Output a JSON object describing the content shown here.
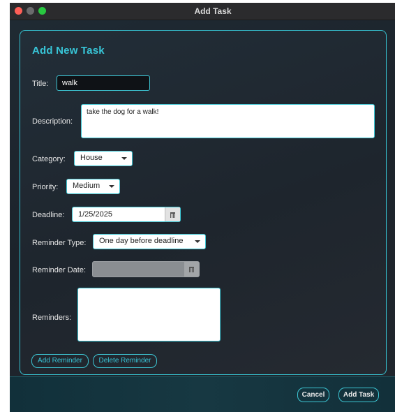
{
  "window": {
    "title": "Add Task"
  },
  "form": {
    "heading": "Add New Task",
    "title": {
      "label": "Title:",
      "value": "walk"
    },
    "description": {
      "label": "Description:",
      "value": "take the dog for a walk!"
    },
    "category": {
      "label": "Category:",
      "value": "House"
    },
    "priority": {
      "label": "Priority:",
      "value": "Medium"
    },
    "deadline": {
      "label": "Deadline:",
      "value": "1/25/2025"
    },
    "reminder_type": {
      "label": "Reminder Type:",
      "value": "One day before deadline"
    },
    "reminder_date": {
      "label": "Reminder Date:",
      "value": ""
    },
    "reminders": {
      "label": "Reminders:"
    },
    "add_reminder_label": "Add Reminder",
    "delete_reminder_label": "Delete Reminder"
  },
  "footer": {
    "cancel_label": "Cancel",
    "add_task_label": "Add Task"
  },
  "colors": {
    "accent": "#38c6d8",
    "background": "#1f262e",
    "footer": "#173842"
  },
  "icons": [
    "calendar-icon",
    "chevron-down-icon"
  ]
}
